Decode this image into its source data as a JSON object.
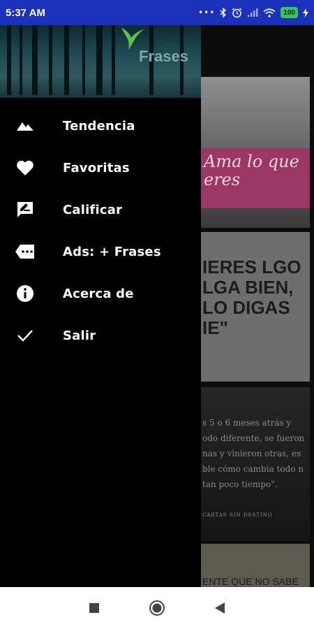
{
  "status_bar": {
    "time": "5:37 AM",
    "battery": "100",
    "icons": [
      "dots-icon",
      "bluetooth-icon",
      "alarm-icon",
      "signal-icon",
      "wifi-icon",
      "battery-icon",
      "charging-icon"
    ]
  },
  "drawer": {
    "header_logo": "Frases",
    "menu": [
      {
        "label": "Tendencia",
        "icon": "trending-icon"
      },
      {
        "label": "Favoritas",
        "icon": "heart-icon"
      },
      {
        "label": "Calificar",
        "icon": "rate-review-icon"
      },
      {
        "label": "Ads: + Frases",
        "icon": "ads-tag-icon"
      },
      {
        "label": "Acerca de",
        "icon": "info-icon"
      },
      {
        "label": "Salir",
        "icon": "check-icon"
      }
    ]
  },
  "feed": {
    "card1_text": "Ama lo que eres",
    "card2_text": "IERES LGO LGA BIEN, LO DIGAS IE\"",
    "card3_text": "s 5 o 6 meses atrás y odo diferente, se fueron nas y vinieron otras, es ble cómo cambia todo n tan poco tiempo\".",
    "card3_footer": "CARTAS SIN DESTINO",
    "card4_text": "ENTE QUE NO SABE"
  },
  "nav_bar": {
    "buttons": [
      "recents-icon",
      "home-icon",
      "back-icon"
    ]
  },
  "colors": {
    "status_bar_bg": "#1b32b8",
    "drawer_bg": "#000000",
    "menu_text": "#ffffff",
    "pink_accent": "#9a3763"
  }
}
